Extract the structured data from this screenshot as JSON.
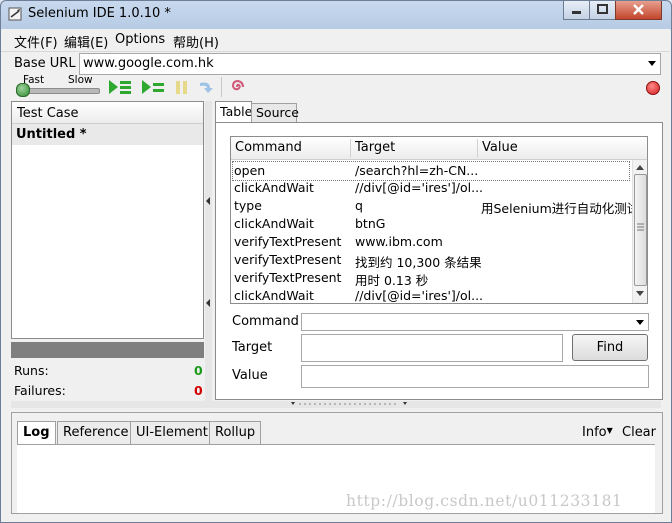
{
  "window": {
    "title": "Selenium IDE 1.0.10 *"
  },
  "menu": [
    {
      "label": "文件(F)"
    },
    {
      "label": "编辑(E)"
    },
    {
      "label": "Options"
    },
    {
      "label": "帮助(H)"
    }
  ],
  "base_url": {
    "label": "Base URL",
    "value": "www.google.com.hk"
  },
  "speed": {
    "fast_label": "Fast",
    "slow_label": "Slow"
  },
  "left_panel": {
    "header": "Test Case",
    "items": [
      {
        "label": "Untitled *"
      }
    ],
    "runs_label": "Runs:",
    "runs_value": "0",
    "failures_label": "Failures:",
    "failures_value": "0"
  },
  "editor_tabs": [
    {
      "label": "Table"
    },
    {
      "label": "Source"
    }
  ],
  "table": {
    "headers": [
      "Command",
      "Target",
      "Value"
    ],
    "rows": [
      {
        "command": "open",
        "target": "/search?hl=zh-CN...",
        "value": ""
      },
      {
        "command": "clickAndWait",
        "target": "//div[@id='ires']/ol...",
        "value": ""
      },
      {
        "command": "type",
        "target": "q",
        "value": "用Selenium进行自动化测试"
      },
      {
        "command": "clickAndWait",
        "target": "btnG",
        "value": ""
      },
      {
        "command": "verifyTextPresent",
        "target": "www.ibm.com",
        "value": ""
      },
      {
        "command": "verifyTextPresent",
        "target": "找到约 10,300 条结果",
        "value": ""
      },
      {
        "command": "verifyTextPresent",
        "target": "用时 0.13 秒",
        "value": ""
      },
      {
        "command": "clickAndWait",
        "target": "//div[@id='ires']/ol...",
        "value": ""
      }
    ]
  },
  "form": {
    "command_label": "Command",
    "target_label": "Target",
    "value_label": "Value",
    "find_label": "Find",
    "command_value": "",
    "target_value": "",
    "value_value": ""
  },
  "bottom_tabs": [
    {
      "label": "Log"
    },
    {
      "label": "Reference"
    },
    {
      "label": "UI-Element"
    },
    {
      "label": "Rollup"
    }
  ],
  "bottom_right": {
    "info_label": "Info",
    "clear_label": "Clear"
  },
  "watermark": "http://blog.csdn.net/u011233181",
  "colors": {
    "runs": "#1a9a1a",
    "failures": "#d20000",
    "play_green": "#2fa82f",
    "record_red": "#e02020"
  }
}
